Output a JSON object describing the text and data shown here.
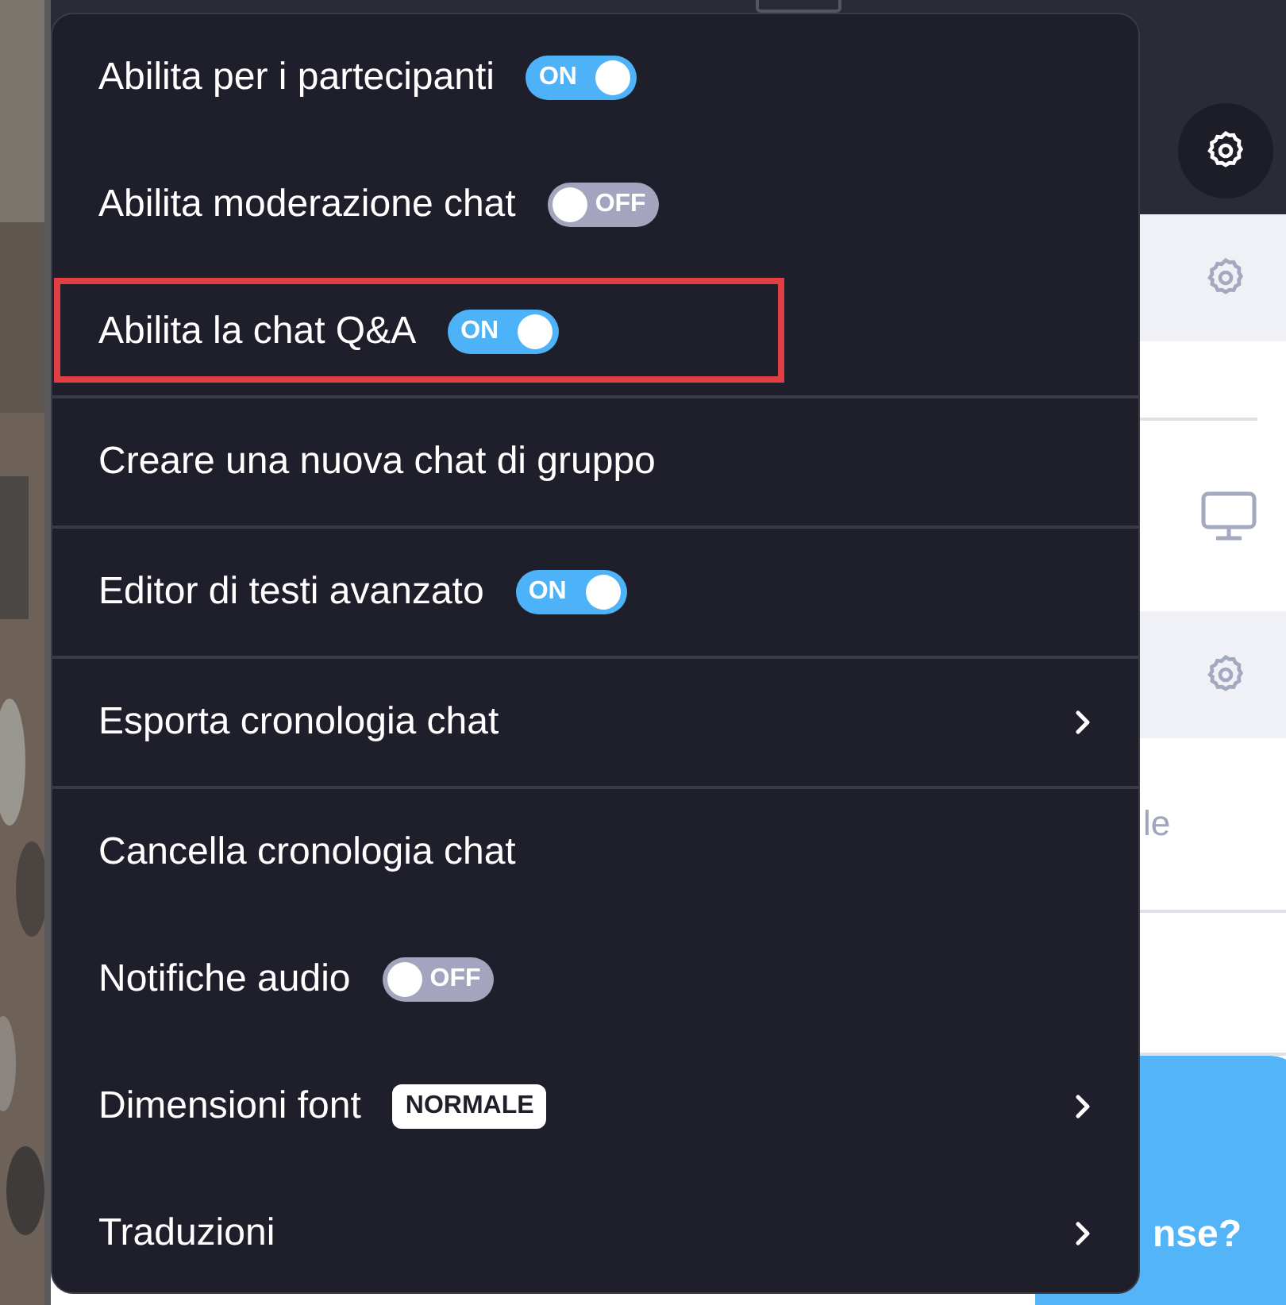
{
  "background": {
    "snippet_text": "le",
    "bubble_text": "nse?"
  },
  "menu": {
    "sections": [
      {
        "items": [
          {
            "kind": "toggle",
            "label": "Abilita per i partecipanti",
            "on": true,
            "toggle_text": "ON",
            "highlighted": false
          },
          {
            "kind": "toggle",
            "label": "Abilita moderazione chat",
            "on": false,
            "toggle_text": "OFF",
            "highlighted": false
          },
          {
            "kind": "toggle",
            "label": "Abilita la chat Q&A",
            "on": true,
            "toggle_text": "ON",
            "highlighted": true
          }
        ]
      },
      {
        "items": [
          {
            "kind": "action",
            "label": "Creare una nuova chat di gruppo",
            "highlighted": false
          }
        ]
      },
      {
        "items": [
          {
            "kind": "toggle",
            "label": "Editor di testi avanzato",
            "on": true,
            "toggle_text": "ON",
            "highlighted": false
          }
        ]
      },
      {
        "items": [
          {
            "kind": "submenu",
            "label": "Esporta cronologia chat",
            "highlighted": false
          }
        ]
      },
      {
        "items": [
          {
            "kind": "action",
            "label": "Cancella cronologia chat",
            "highlighted": false
          },
          {
            "kind": "toggle",
            "label": "Notifiche audio",
            "on": false,
            "toggle_text": "OFF",
            "highlighted": false
          },
          {
            "kind": "submenu",
            "label": "Dimensioni font",
            "badge": "NORMALE",
            "highlighted": false
          },
          {
            "kind": "submenu",
            "label": "Traduzioni",
            "highlighted": false
          }
        ]
      }
    ]
  }
}
